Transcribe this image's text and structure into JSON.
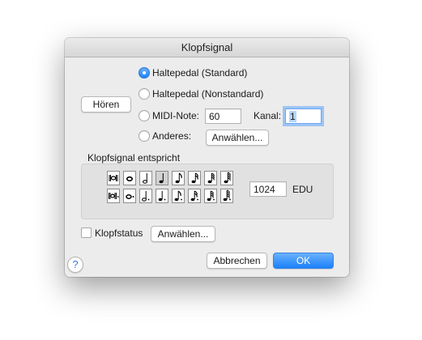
{
  "dialog": {
    "title": "Klopfsignal",
    "listen_button": "Hören",
    "options": [
      {
        "label": "Haltepedal (Standard)",
        "selected": true
      },
      {
        "label": "Haltepedal (Nonstandard)",
        "selected": false
      },
      {
        "label": "MIDI-Note:",
        "selected": false
      },
      {
        "label": "Anderes:",
        "selected": false
      }
    ],
    "midi_note_value": "60",
    "kanal_label": "Kanal:",
    "kanal_value": "1",
    "anderes_select_button": "Anwählen...",
    "group_label": "Klopfsignal entspricht",
    "note_rows": [
      {
        "icons": [
          "double-whole-note-icon",
          "whole-note-icon",
          "half-note-icon",
          "quarter-note-icon",
          "eighth-note-icon",
          "sixteenth-note-icon",
          "thirty-second-note-icon",
          "sixty-fourth-note-icon"
        ],
        "selected_index": 3
      },
      {
        "icons": [
          "dotted-double-whole-note-icon",
          "dotted-whole-note-icon",
          "dotted-half-note-icon",
          "dotted-quarter-note-icon",
          "dotted-eighth-note-icon",
          "dotted-sixteenth-note-icon",
          "dotted-thirty-second-note-icon",
          "dotted-sixty-fourth-note-icon"
        ],
        "selected_index": null
      }
    ],
    "edu_value": "1024",
    "edu_unit": "EDU",
    "klopfstatus_label": "Klopfstatus",
    "klopfstatus_checked": false,
    "klopfstatus_select_button": "Anwählen...",
    "help_label": "?",
    "cancel_button": "Abbrechen",
    "ok_button": "OK"
  }
}
